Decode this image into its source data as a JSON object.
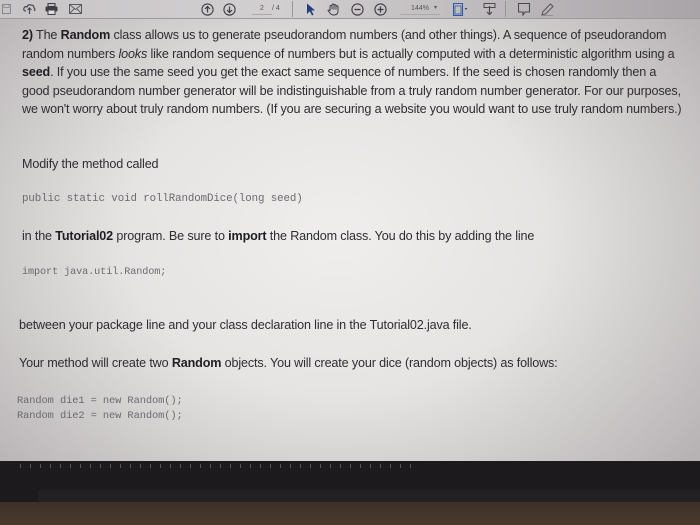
{
  "toolbar": {
    "icons": [
      "save-icon",
      "upload-cloud-icon",
      "print-icon",
      "email-icon",
      "previous-page-icon",
      "next-page-icon",
      "select-cursor-icon",
      "hand-pan-icon",
      "zoom-out-icon",
      "zoom-in-icon",
      "page-fit-icon",
      "download-icon",
      "comment-icon",
      "pen-icon"
    ],
    "page_current": "2",
    "page_total": "/ 4",
    "zoom_level": "144%",
    "zoom_caret": "▾"
  },
  "document": {
    "p1": {
      "num": "2)",
      "t1": " The ",
      "b1": "Random",
      "t2": " class allows us to generate pseudorandom numbers (and other things). A sequence of pseudorandom random numbers ",
      "i1": "looks",
      "t3": " like random sequence of numbers but is actually computed with a deterministic algorithm using a ",
      "b2": "seed",
      "t4": ". If you use the same seed you get the exact same sequence of numbers. If the seed is chosen randomly then a good pseudorandom number generator will be indistinguishable from a truly random number generator. For our purposes, we won't worry about truly random numbers. (If you are securing a website you would want to use truly random numbers.)"
    },
    "p2": "Modify the method called",
    "code1": "public static void rollRandomDice(long seed)",
    "p3": {
      "t1": "in the ",
      "b1": "Tutorial02",
      "t2": " program. Be sure to ",
      "b2": "import",
      "t3": " the Random class. You do this by adding the line"
    },
    "code2": "import java.util.Random;",
    "p4": "between your package line and your class declaration line in the Tutorial02.java file.",
    "p5": {
      "t1": "Your method will create two ",
      "b1": "Random",
      "t2": " objects. You will create your dice (random objects) as follows:"
    },
    "code3": [
      "Random die1 = new Random();",
      "Random die2 = new Random();"
    ]
  }
}
